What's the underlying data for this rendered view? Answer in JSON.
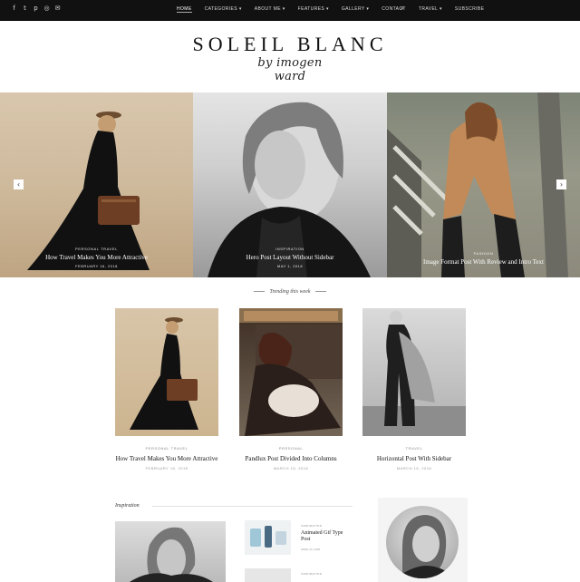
{
  "social": {
    "icons": [
      "facebook-icon",
      "twitter-icon",
      "pinterest-icon",
      "instagram-icon",
      "email-icon"
    ]
  },
  "nav": {
    "items": [
      "HOME",
      "CATEGORIES",
      "ABOUT ME",
      "FEATURES",
      "GALLERY",
      "CONTACT",
      "TRAVEL",
      "SUBSCRIBE"
    ],
    "active": "HOME"
  },
  "header": {
    "title": "SOLEIL BLANC",
    "script": "by imogen ward"
  },
  "slider": {
    "slides": [
      {
        "category": "PERSONAL    TRAVEL",
        "title": "How Travel Makes You More Attractive",
        "date": "FEBRUARY 16, 2018"
      },
      {
        "category": "INSPIRATION",
        "title": "Hero Post Layout Without Sidebar",
        "date": "MAY 1, 2018"
      },
      {
        "category": "FASHION",
        "title": "Image Format Post With Review and Intro Text",
        "date": ""
      }
    ],
    "prev_arrow": "‹",
    "next_arrow": "›"
  },
  "trending": {
    "label": "Trending this week",
    "posts": [
      {
        "category": "PERSONAL    TRAVEL",
        "title": "How Travel Makes You More Attractive",
        "date": "FEBRUARY 16, 2018"
      },
      {
        "category": "PERSONAL",
        "title": "Pandlux Post Divided Into Columns",
        "date": "MARCH 15, 2018"
      },
      {
        "category": "TRAVEL",
        "title": "Horizontal Post With Sidebar",
        "date": "MARCH 15, 2018"
      }
    ]
  },
  "inspiration": {
    "label": "Inspiration",
    "side_posts": [
      {
        "category": "INSPIRATION",
        "title": "Animated Gif Type Post",
        "date": "APRIL 23, 2018"
      },
      {
        "category": "INSPIRATION",
        "title": "",
        "date": ""
      }
    ]
  }
}
